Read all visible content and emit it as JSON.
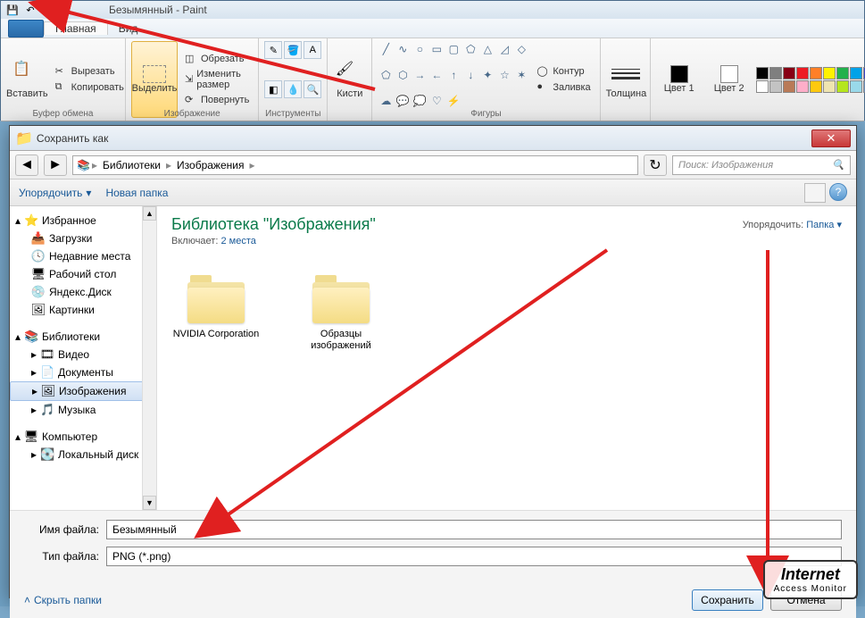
{
  "paint": {
    "title": "Безымянный - Paint",
    "tabs": {
      "home": "Главная",
      "view": "Вид"
    },
    "clipboard": {
      "paste": "Вставить",
      "cut": "Вырезать",
      "copy": "Копировать",
      "label": "Буфер обмена"
    },
    "image": {
      "select": "Выделить",
      "crop": "Обрезать",
      "resize": "Изменить размер",
      "rotate": "Повернуть",
      "label": "Изображение"
    },
    "tools": {
      "label": "Инструменты"
    },
    "brushes": {
      "label": "Кисти"
    },
    "shapes": {
      "outline": "Контур",
      "fill": "Заливка",
      "label": "Фигуры"
    },
    "size": {
      "label": "Толщина"
    },
    "colors": {
      "c1": "Цвет 1",
      "c2": "Цвет 2",
      "c1_hex": "#000000",
      "c2_hex": "#ffffff"
    },
    "palette": [
      "#000000",
      "#7f7f7f",
      "#880015",
      "#ed1c24",
      "#ff7f27",
      "#fff200",
      "#22b14c",
      "#00a2e8",
      "#3f48cc",
      "#a349a4",
      "#ffffff",
      "#c3c3c3",
      "#b97a57",
      "#ffaec9",
      "#ffc90e",
      "#efe4b0",
      "#b5e61d",
      "#99d9ea",
      "#7092be",
      "#c8bfe7"
    ]
  },
  "dialog": {
    "title": "Сохранить как",
    "breadcrumbs": [
      "Библиотеки",
      "Изображения"
    ],
    "search_placeholder": "Поиск: Изображения",
    "organize": "Упорядочить",
    "new_folder": "Новая папка",
    "sort_label": "Упорядочить:",
    "sort_value": "Папка",
    "tree": {
      "favorites": "Избранное",
      "fav_items": [
        "Загрузки",
        "Недавние места",
        "Рабочий стол",
        "Яндекс.Диск",
        "Картинки"
      ],
      "libraries": "Библиотеки",
      "lib_items": [
        "Видео",
        "Документы",
        "Изображения",
        "Музыка"
      ],
      "computer": "Компьютер",
      "comp_items": [
        "Локальный диск"
      ]
    },
    "library_title": "Библиотека \"Изображения\"",
    "includes_label": "Включает:",
    "includes_count": "2 места",
    "folders": [
      "NVIDIA Corporation",
      "Образцы изображений"
    ],
    "filename_label": "Имя файла:",
    "filename_value": "Безымянный",
    "filetype_label": "Тип файла:",
    "filetype_value": "PNG (*.png)",
    "hide_folders": "Скрыть папки",
    "save_btn": "Сохранить",
    "cancel_btn": "Отмена"
  },
  "watermark": {
    "line1": "Internet",
    "line2": "Access Monitor"
  }
}
